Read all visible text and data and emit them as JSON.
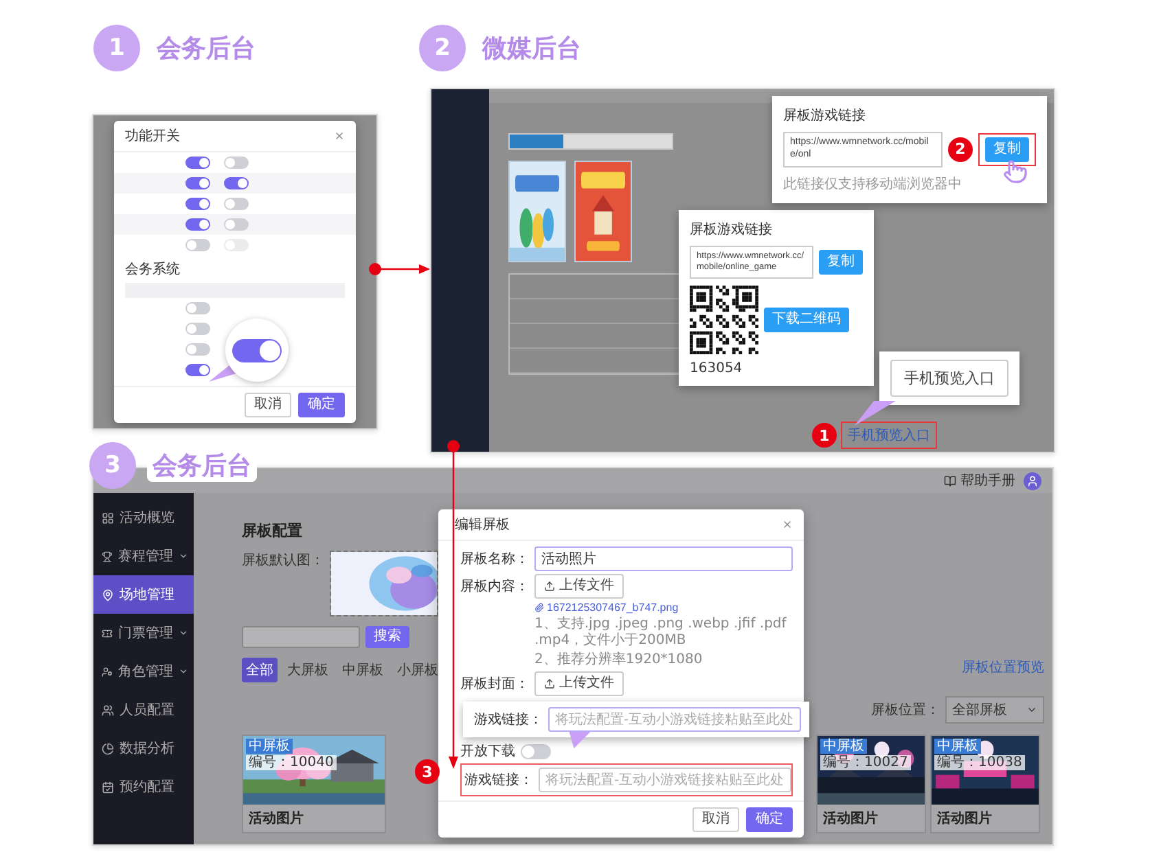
{
  "steps": [
    {
      "number": "1",
      "title": "会务后台"
    },
    {
      "number": "2",
      "title": "微媒后台"
    },
    {
      "number": "3",
      "title": "会务后台"
    }
  ],
  "panel_1": {
    "dialog": {
      "title": "功能开关",
      "switch_rows": [
        {
          "switches": [
            {
              "on": true,
              "disabled": false
            },
            {
              "on": false,
              "disabled": false
            }
          ]
        },
        {
          "switches": [
            {
              "on": true,
              "disabled": false
            },
            {
              "on": true,
              "disabled": false
            }
          ]
        },
        {
          "switches": [
            {
              "on": true,
              "disabled": false
            },
            {
              "on": false,
              "disabled": false
            }
          ]
        },
        {
          "switches": [
            {
              "on": true,
              "disabled": false
            },
            {
              "on": false,
              "disabled": false
            }
          ]
        },
        {
          "switches": [
            {
              "on": false,
              "disabled": false
            },
            {
              "on": false,
              "disabled": true
            }
          ]
        }
      ],
      "section": "会务系统",
      "system_rows": [
        {
          "on": false
        },
        {
          "on": false
        },
        {
          "on": false
        },
        {
          "on": true
        }
      ],
      "buttons": [
        {
          "label": "取消",
          "kind": "secondary"
        },
        {
          "label": "确定",
          "kind": "primary"
        }
      ]
    },
    "zoom_switch": {
      "on": true
    }
  },
  "panel_2": {
    "link_popup": {
      "title": "屏板游戏链接",
      "url": "https://www.wmnetwork.cc/mobile/onl",
      "marker": "2",
      "copy": "复制",
      "hint": "此链接仅支持移动端浏览器中"
    },
    "share_popup": {
      "title": "屏板游戏链接",
      "url": "https://www.wmnetwork.cc/mobile/online_game",
      "copy": "复制",
      "download": "下载二维码",
      "code": "163054"
    },
    "callout": "手机预览入口",
    "preview_marker": "1",
    "preview_link": "手机预览入口"
  },
  "panel_3": {
    "header_link": "帮助手册",
    "sidebar": [
      {
        "label": "活动概览",
        "selected": false,
        "submenu": false
      },
      {
        "label": "赛程管理",
        "selected": false,
        "submenu": true
      },
      {
        "label": "场地管理",
        "selected": true,
        "submenu": false
      },
      {
        "label": "门票管理",
        "selected": false,
        "submenu": true
      },
      {
        "label": "角色管理",
        "selected": false,
        "submenu": true
      },
      {
        "label": "人员配置",
        "selected": false,
        "submenu": false
      },
      {
        "label": "数据分析",
        "selected": false,
        "submenu": false
      },
      {
        "label": "预约配置",
        "selected": false,
        "submenu": false
      }
    ],
    "section_title": "屏板配置",
    "default_image_label": "屏板默认图：",
    "search_button": "搜索",
    "filters": [
      {
        "label": "全部",
        "selected": true
      },
      {
        "label": "大屏板",
        "selected": false
      },
      {
        "label": "中屏板",
        "selected": false
      },
      {
        "label": "小屏板",
        "selected": false
      }
    ],
    "preview_link": "屏板位置预览",
    "position_label": "屏板位置：",
    "position_value": "全部屏板",
    "cards": [
      {
        "badge": "中屏板",
        "number": "编号：10040",
        "title": "活动图片"
      },
      {
        "badge": "中屏板",
        "number": "编号：10027",
        "title": "活动图片"
      },
      {
        "badge": "中屏板",
        "number": "编号：10038",
        "title": "活动图片"
      }
    ],
    "dialog": {
      "title": "编辑屏板",
      "name_label": "屏板名称：",
      "name_value": "活动照片",
      "content_label": "屏板内容：",
      "upload": "上传文件",
      "file": "1672125307467_b747.png",
      "notes": [
        "1、支持.jpg .jpeg .png .webp .jfif .pdf .mp4，文件小于200MB",
        "2、推荐分辨率1920*1080"
      ],
      "cover_label": "屏板封面：",
      "cover_upload": "上传文件",
      "download_label": "开放下载",
      "download_on": false,
      "link_label": "游戏链接：",
      "link_placeholder": "将玩法配置-互动小游戏链接粘贴至此处",
      "marker": "3",
      "buttons": [
        {
          "label": "取消",
          "kind": "secondary"
        },
        {
          "label": "确定",
          "kind": "primary"
        }
      ]
    },
    "callout": {
      "label": "游戏链接：",
      "placeholder": "将玩法配置-互动小游戏链接粘贴至此处"
    }
  }
}
